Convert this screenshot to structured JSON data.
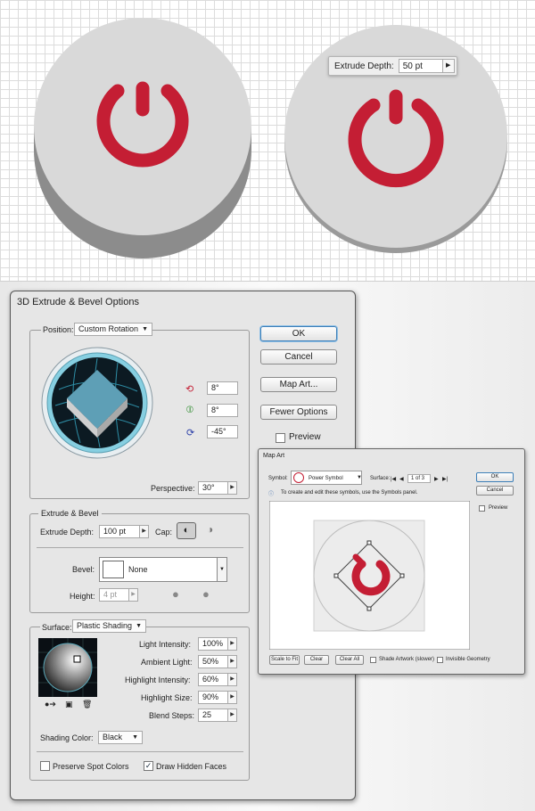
{
  "colors": {
    "power_red": "#c41e34",
    "button_face": "#d8d8d8",
    "button_side": "#8a8a8a",
    "cube_top": "#5e9fb6"
  },
  "extrude_tooltip": {
    "label": "Extrude Depth:",
    "value": "50 pt"
  },
  "dialog": {
    "title": "3D Extrude & Bevel Options",
    "position": {
      "label": "Position:",
      "value": "Custom Rotation",
      "rot_x": "8°",
      "rot_y": "8°",
      "rot_z": "-45°",
      "perspective_label": "Perspective:",
      "perspective": "30°"
    },
    "buttons": {
      "ok": "OK",
      "cancel": "Cancel",
      "map_art": "Map Art...",
      "fewer_options": "Fewer Options",
      "preview": "Preview"
    },
    "extrude_bevel": {
      "legend": "Extrude & Bevel",
      "depth_label": "Extrude Depth:",
      "depth": "100 pt",
      "cap_label": "Cap:",
      "bevel_label": "Bevel:",
      "bevel": "None",
      "height_label": "Height:",
      "height": "4 pt"
    },
    "surface": {
      "label": "Surface:",
      "value": "Plastic Shading",
      "light_intensity_label": "Light Intensity:",
      "light_intensity": "100%",
      "ambient_light_label": "Ambient Light:",
      "ambient_light": "50%",
      "highlight_intensity_label": "Highlight Intensity:",
      "highlight_intensity": "60%",
      "highlight_size_label": "Highlight Size:",
      "highlight_size": "90%",
      "blend_steps_label": "Blend Steps:",
      "blend_steps": "25",
      "shading_color_label": "Shading Color:",
      "shading_color": "Black"
    },
    "preserve_spot": "Preserve Spot Colors",
    "draw_hidden": "Draw Hidden Faces"
  },
  "map_art": {
    "title": "Map Art",
    "symbol_label": "Symbol:",
    "symbol": "Power Symbol",
    "surface_label": "Surface:",
    "surface": "1 of 3",
    "info": "To create and edit these symbols, use the Symbols panel.",
    "ok": "OK",
    "cancel": "Cancel",
    "preview": "Preview",
    "scale_to_fit": "Scale to Fit",
    "clear": "Clear",
    "clear_all": "Clear All",
    "shade_artwork": "Shade Artwork (slower)",
    "invisible_geometry": "Invisible Geometry"
  }
}
